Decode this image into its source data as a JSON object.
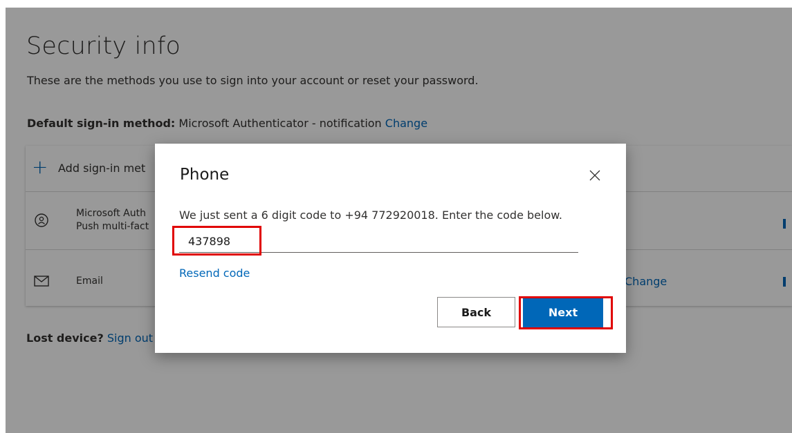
{
  "page": {
    "title": "Security info",
    "subtitle": "These are the methods you use to sign into your account or reset your password.",
    "default_method_label": "Default sign-in method:",
    "default_method_value": "Microsoft Authenticator - notification",
    "change_link": "Change"
  },
  "methods": {
    "add_label": "Add sign-in met",
    "authenticator_line1": "Microsoft Auth",
    "authenticator_line2": "Push multi-fact",
    "email_label": "Email",
    "email_change": "Change"
  },
  "lost_device": {
    "label": "Lost device?",
    "link": "Sign out"
  },
  "dialog": {
    "title": "Phone",
    "message": "We just sent a 6 digit code to +94 772920018. Enter the code below.",
    "code_value": "437898",
    "resend_label": "Resend code",
    "back_label": "Back",
    "next_label": "Next"
  },
  "colors": {
    "accent": "#0067b8",
    "highlight": "#e00000",
    "overlay": "rgba(0,0,0,0.40)"
  },
  "icons": {
    "add": "plus-icon",
    "authenticator": "authenticator-lock-icon",
    "email": "envelope-icon",
    "close": "close-icon"
  }
}
